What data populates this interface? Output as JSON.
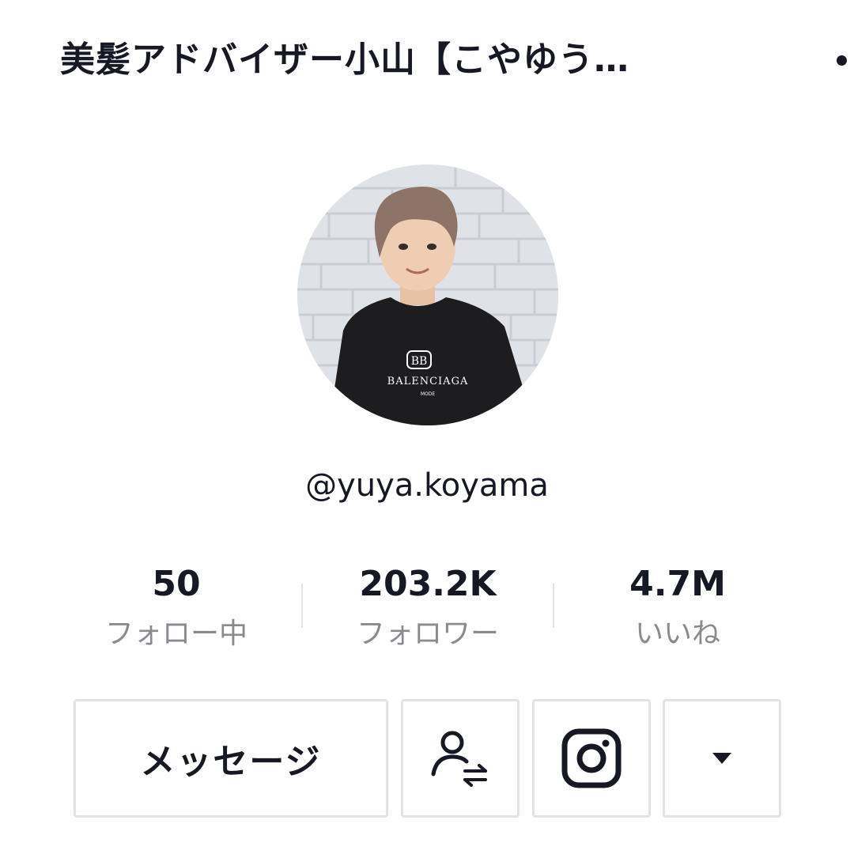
{
  "header": {
    "title": "美髪アドバイザー小山【こやゆう…",
    "more_icon": "more-icon"
  },
  "profile": {
    "avatar_icon": "profile-photo",
    "avatar_shirt_text": "BALENCIAGA",
    "avatar_shirt_subtext": "MODE",
    "avatar_shirt_logo": "BB",
    "username": "@yuya.koyama"
  },
  "stats": [
    {
      "value": "50",
      "label": "フォロー中"
    },
    {
      "value": "203.2K",
      "label": "フォロワー"
    },
    {
      "value": "4.7M",
      "label": "いいね"
    }
  ],
  "actions": {
    "message_label": "メッセージ",
    "follow_icon": "user-switch-icon",
    "instagram_icon": "instagram-icon",
    "dropdown_icon": "caret-down-icon"
  },
  "colors": {
    "text": "#161823",
    "secondary_text": "#8a8b91",
    "border": "#e3e3e4"
  }
}
